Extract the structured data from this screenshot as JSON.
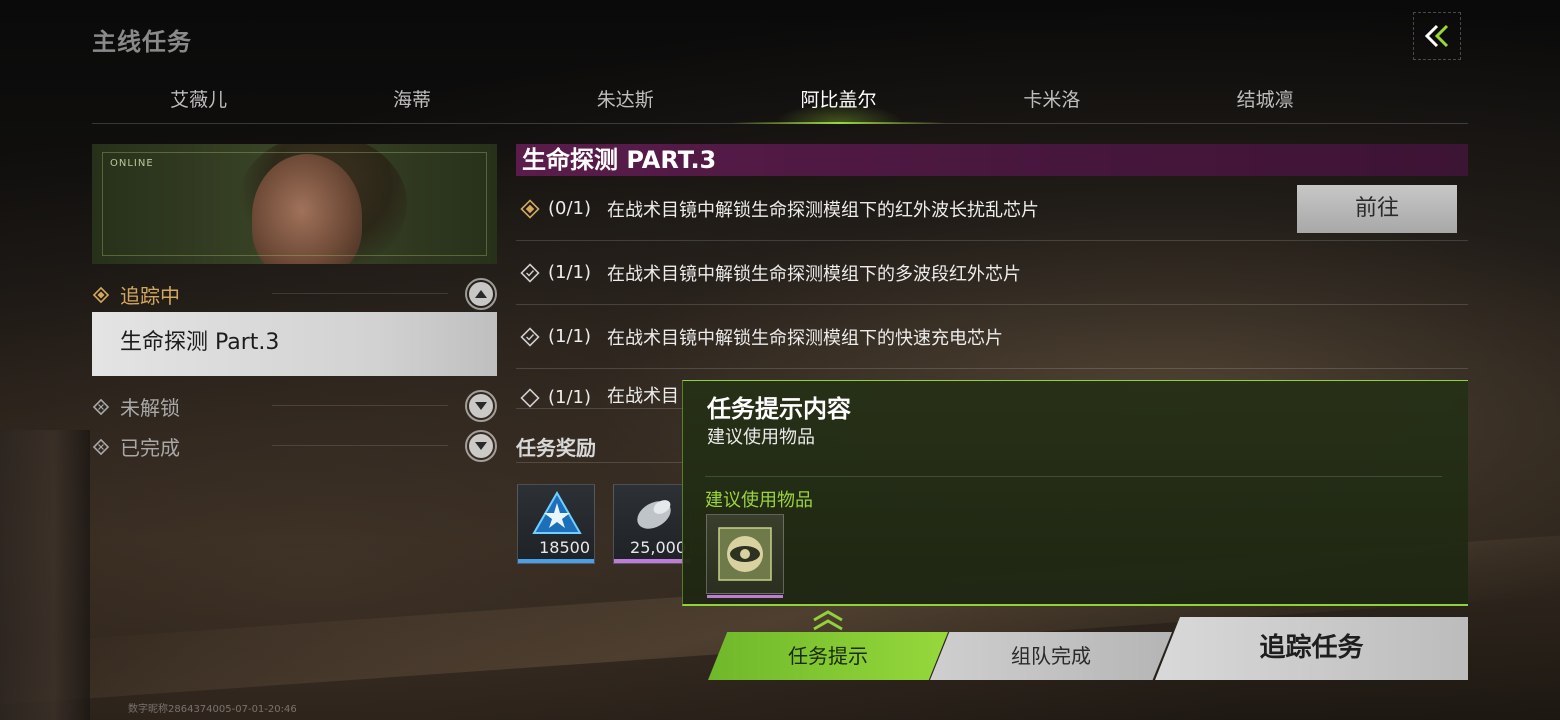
{
  "page": {
    "title": "主线任务"
  },
  "tabs": [
    {
      "label": "艾薇儿"
    },
    {
      "label": "海蒂"
    },
    {
      "label": "朱达斯"
    },
    {
      "label": "阿比盖尔",
      "active": true
    },
    {
      "label": "卡米洛"
    },
    {
      "label": "结城凛"
    }
  ],
  "portrait": {
    "status": "ONLINE"
  },
  "groups": {
    "tracking": {
      "label": "追踪中",
      "expanded": true
    },
    "locked": {
      "label": "未解锁",
      "expanded": false
    },
    "completed": {
      "label": "已完成",
      "expanded": false
    }
  },
  "selected_quest": {
    "label": "生命探测 Part.3"
  },
  "quest": {
    "title": "生命探测 PART.3",
    "objectives": [
      {
        "progress": "(0/1)",
        "text": "在战术目镜中解锁生命探测模组下的红外波长扰乱芯片",
        "status": "active"
      },
      {
        "progress": "(1/1)",
        "text": "在战术目镜中解锁生命探测模组下的多波段红外芯片",
        "status": "done"
      },
      {
        "progress": "(1/1)",
        "text": "在战术目镜中解锁生命探测模组下的快速充电芯片",
        "status": "done"
      },
      {
        "progress": "(1/1)",
        "text": "在战术目",
        "status": "done"
      }
    ],
    "goto_label": "前往"
  },
  "rewards": {
    "title": "任务奖励",
    "items": [
      {
        "icon": "exp-badge-icon",
        "amount": "18500",
        "rarity_color": "#4aa0e8"
      },
      {
        "icon": "coin-roll-icon",
        "amount": "25,000",
        "rarity_color": "#c07ad8"
      }
    ]
  },
  "hint_panel": {
    "title": "任务提示内容",
    "subtitle": "建议使用物品",
    "section_label": "建议使用物品",
    "item_icon": "eye-chip-icon"
  },
  "bottom_buttons": {
    "hint": "任务提示",
    "team": "组队完成",
    "track": "追踪任务"
  },
  "watermark": "数字昵称2864374005-07-01-20:46",
  "colors": {
    "accent_green": "#96d83c",
    "title_bar": "#5a1c4b",
    "tracking_gold": "#d4a85c"
  }
}
